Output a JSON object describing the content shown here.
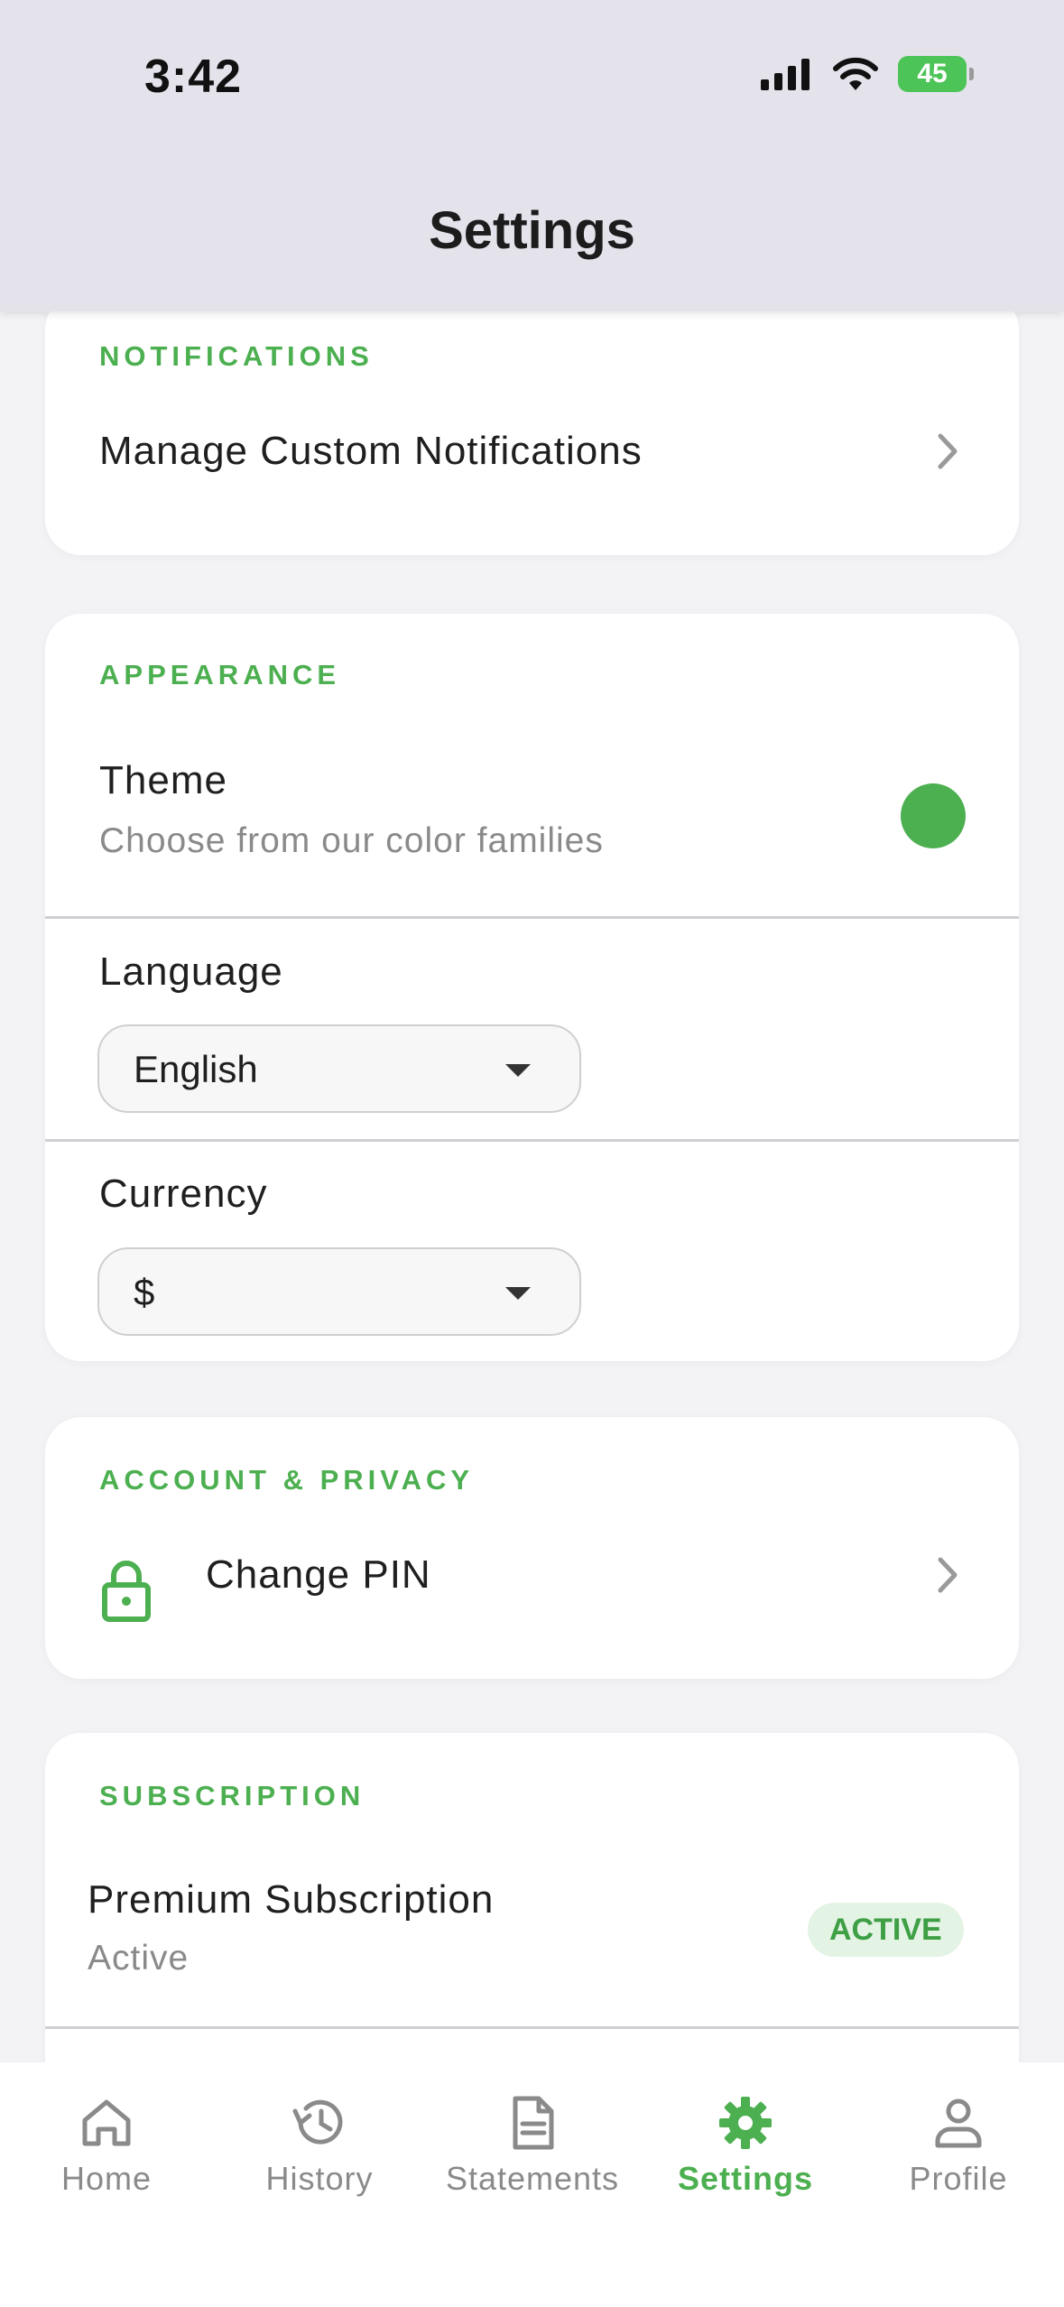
{
  "status_bar": {
    "time": "3:42",
    "battery": "45"
  },
  "header": {
    "title": "Settings"
  },
  "sections": {
    "notifications": {
      "label": "NOTIFICATIONS",
      "manage_label": "Manage Custom Notifications"
    },
    "appearance": {
      "label": "APPEARANCE",
      "theme_title": "Theme",
      "theme_subtitle": "Choose from our color families",
      "theme_color": "#4caf50",
      "language_label": "Language",
      "language_value": "English",
      "currency_label": "Currency",
      "currency_value": "$"
    },
    "account_privacy": {
      "label": "ACCOUNT & PRIVACY",
      "change_pin_label": "Change PIN"
    },
    "subscription": {
      "label": "SUBSCRIPTION",
      "title": "Premium Subscription",
      "status_text": "Active",
      "badge": "ACTIVE"
    }
  },
  "bottom_nav": {
    "items": [
      {
        "label": "Home",
        "icon": "home-icon"
      },
      {
        "label": "History",
        "icon": "history-icon"
      },
      {
        "label": "Statements",
        "icon": "document-icon"
      },
      {
        "label": "Settings",
        "icon": "gear-icon",
        "active": true
      },
      {
        "label": "Profile",
        "icon": "person-icon"
      }
    ]
  },
  "colors": {
    "accent": "#4caf50",
    "header_bg": "#e4e3ec",
    "page_bg": "#f3f3f6"
  }
}
